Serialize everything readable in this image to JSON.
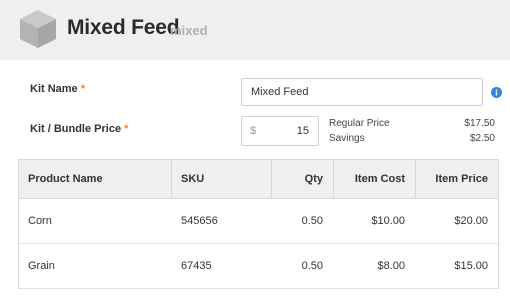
{
  "header": {
    "title": "Mixed Feed",
    "subtitle": "mixed"
  },
  "form": {
    "kit_name_label": "Kit Name",
    "kit_name_value": "Mixed Feed",
    "required_mark": "*",
    "price_label": "Kit / Bundle Price",
    "currency_symbol": "$",
    "price_value": "15",
    "regular_price_label": "Regular Price",
    "regular_price_value": "$17.50",
    "savings_label": "Savings",
    "savings_value": "$2.50"
  },
  "table": {
    "columns": [
      "Product Name",
      "SKU",
      "Qty",
      "Item Cost",
      "Item Price"
    ],
    "rows": [
      [
        "Corn",
        "545656",
        "0.50",
        "$10.00",
        "$20.00"
      ],
      [
        "Grain",
        "67435",
        "0.50",
        "$8.00",
        "$15.00"
      ]
    ]
  },
  "colors": {
    "header_bg": "#efefef",
    "required": "#e8823a",
    "info": "#2e86de"
  },
  "icons": [
    "box-icon",
    "info-icon"
  ]
}
